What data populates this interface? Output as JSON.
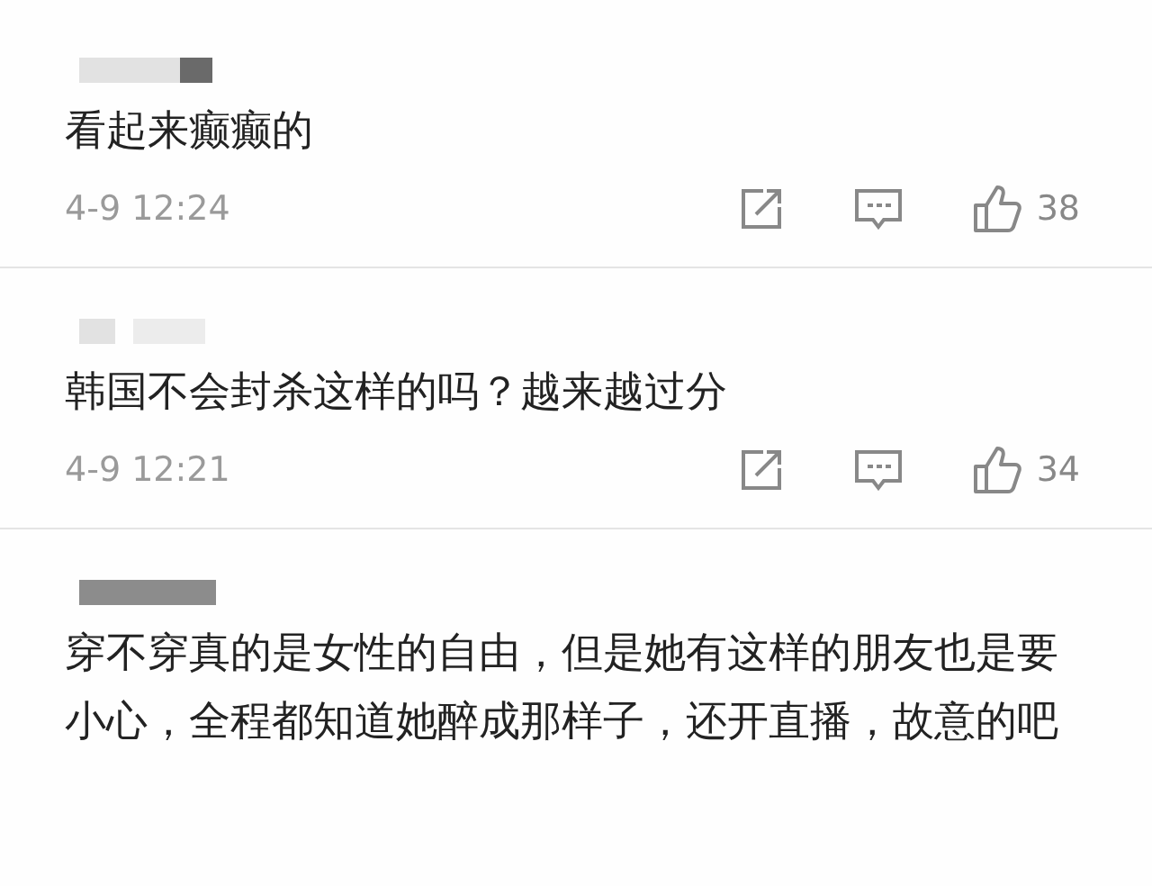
{
  "comments": [
    {
      "text": "看起来癫癫的",
      "time": "4-9 12:24",
      "likes": "38"
    },
    {
      "text": "韩国不会封杀这样的吗？越来越过分",
      "time": "4-9 12:21",
      "likes": "34"
    },
    {
      "text": "穿不穿真的是女性的自由，但是她有这样的朋友也是要小心，全程都知道她醉成那样子，还开直播，故意的吧"
    }
  ]
}
